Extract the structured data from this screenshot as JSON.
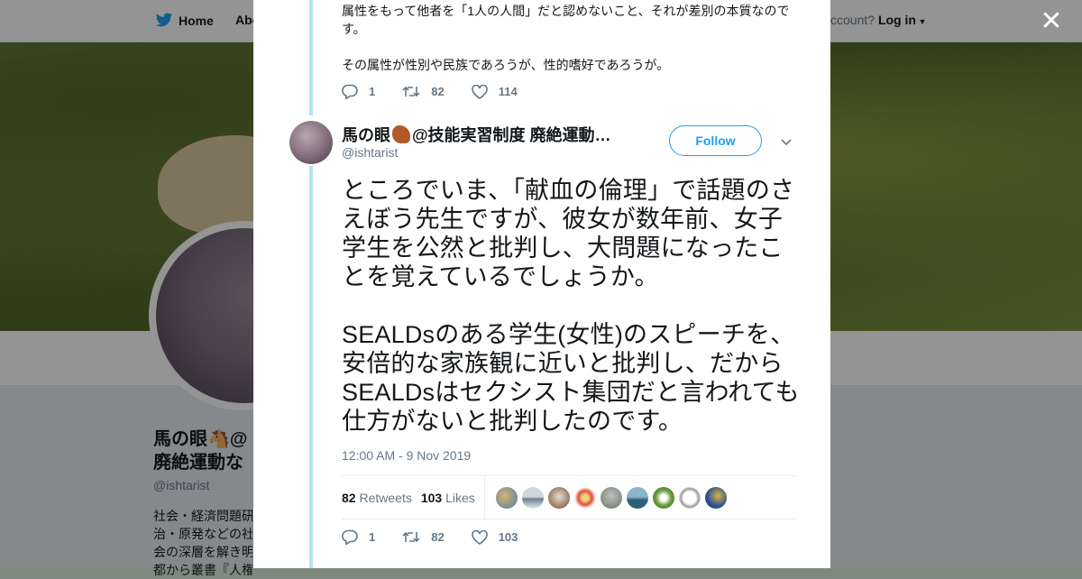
{
  "background": {
    "nav_home": "Home",
    "nav_about": "Abo",
    "account_prompt": "ccount?",
    "login_label": "Log in",
    "profile_name_line1": "馬の眼🐴@",
    "profile_name_line2": "廃絶運動な",
    "profile_handle": "@ishtarist",
    "bio_lines": [
      "社会・経済問題研",
      "治・原発などの社",
      "会の深層を解き明",
      "都から叢書『人権"
    ]
  },
  "previous_tweet": {
    "text_line1": "属性をもって他者を「1人の人間」だと認めないこと、それが差別の本質なので",
    "text_line2": "す。",
    "text_line3": "その属性が性別や民族であろうが、性的嗜好であろうが。",
    "replies": "1",
    "retweets": "82",
    "likes": "114"
  },
  "tweet": {
    "user_name": "馬の眼",
    "user_name_rest": "@技能実習制度 廃絶運動…",
    "handle": "@ishtarist",
    "follow_label": "Follow",
    "text_paragraph1": "ところでいま、「献血の倫理」で話題のさえぼう先生ですが、彼女が数年前、女子学生を公然と批判し、大問題になったことを覚えているでしょうか。",
    "text_paragraph2": "SEALDsのある学生(女性)のスピーチを、安倍的な家族観に近いと批判し、だからSEALDsはセクシスト集団だと言われても仕方がないと批判したのです。",
    "timestamp": "12:00 AM - 9 Nov 2019",
    "retweets_count": "82",
    "retweets_label": "Retweets",
    "likes_count": "103",
    "likes_label": "Likes",
    "replies": "1",
    "retweets": "82",
    "likes": "103"
  },
  "colors": {
    "twitter_blue": "#1da1f2",
    "thread_line": "#b6e1f7",
    "muted_text": "#657786"
  }
}
